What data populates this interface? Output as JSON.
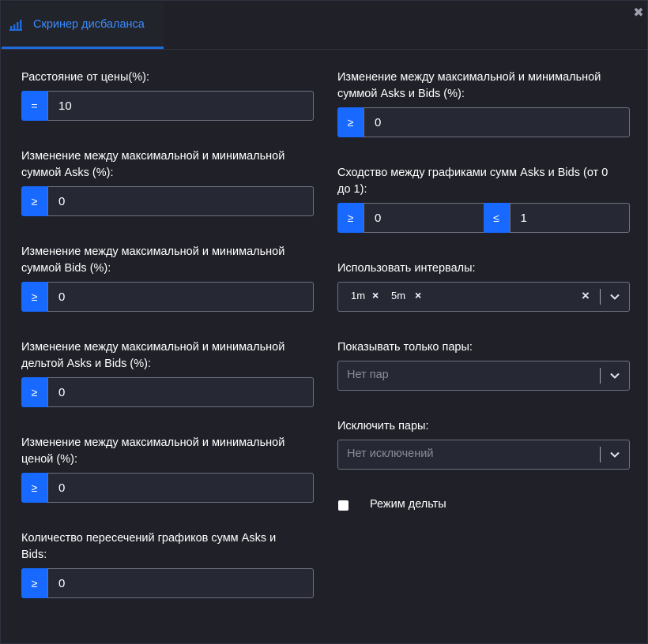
{
  "tab": {
    "label": "Скринер дисбаланса",
    "icon": "bar-chart-icon"
  },
  "close": {
    "symbol": "✖"
  },
  "left": {
    "price_distance": {
      "label": "Расстояние от цены(%):",
      "op": "=",
      "value": "10"
    },
    "asks_change": {
      "label_line1": "Изменение между максимальной и минимальной",
      "label_line2": "суммой Asks (%):",
      "op": "≥",
      "value": "0"
    },
    "bids_change": {
      "label_line1": "Изменение между максимальной и минимальной",
      "label_line2": "суммой Bids (%):",
      "op": "≥",
      "value": "0"
    },
    "delta_change": {
      "label_line1": "Изменение между максимальной и минимальной",
      "label_line2": "дельтой Asks и Bids (%):",
      "op": "≥",
      "value": "0"
    },
    "price_change": {
      "label_line1": "Изменение между максимальной и минимальной",
      "label_line2": "ценой (%):",
      "op": "≥",
      "value": "0"
    },
    "crossings": {
      "label_line1": "Количество пересечений графиков сумм Asks и",
      "label_line2": "Bids:",
      "op": "≥",
      "value": "0"
    }
  },
  "right": {
    "asks_bids_change": {
      "label_line1": "Изменение между максимальной и минимальной",
      "label_line2": "суммой Asks и Bids (%):",
      "op": "≥",
      "value": "0"
    },
    "similarity": {
      "label_line1": "Сходство между графиками сумм Asks и Bids (от 0",
      "label_line2": "до 1):",
      "op_min": "≥",
      "min": "0",
      "op_max": "≤",
      "max": "1"
    },
    "intervals": {
      "label": "Использовать интервалы:",
      "chips": [
        "1m",
        "5m"
      ],
      "chip_remove": "×",
      "clear": "×"
    },
    "only_pairs": {
      "label": "Показывать только пары:",
      "placeholder": "Нет пар"
    },
    "exclude_pairs": {
      "label": "Исключить пары:",
      "placeholder": "Нет исключений"
    },
    "delta_mode": {
      "label": "Режим дельты",
      "checked": false
    }
  },
  "colors": {
    "accent": "#1769ff",
    "tab_text": "#3a8cff",
    "background": "#1f2028",
    "input_bg": "#262833"
  }
}
